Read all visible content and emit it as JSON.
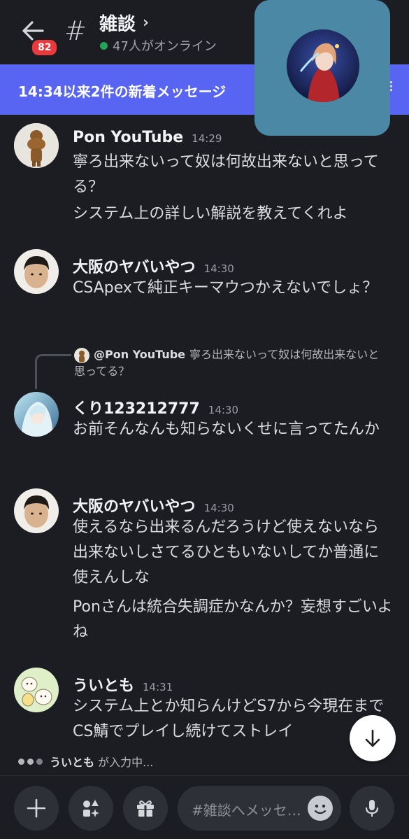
{
  "header": {
    "unread_badge": "82",
    "channel_name": "雑談",
    "online_text": "47人がオンライン"
  },
  "banner": {
    "text": "14:34以来2件の新着メッセージ"
  },
  "messages": [
    {
      "author": "Pon YouTube",
      "time": "14:29",
      "lines": [
        "寧ろ出来ないって奴は何故出来ないと思ってる？",
        "システム上の詳しい解説を教えてくれよ"
      ]
    },
    {
      "author": "大阪のヤバいやつ",
      "time": "14:30",
      "lines": [
        "CSApexて純正キーマウつかえないでしょ？"
      ]
    },
    {
      "author": "くり123212777",
      "time": "14:30",
      "reply": {
        "author": "@Pon YouTube",
        "text": "寧ろ出来ないって奴は何故出来ないと思ってる？"
      },
      "lines": [
        "お前そんなんも知らないくせに言ってたんか"
      ]
    },
    {
      "author": "大阪のヤバいやつ",
      "time": "14:30",
      "lines": [
        "使えるなら出来るんだろうけど使えないなら出来ないしさてるひともいないしてか普通に使えんしな",
        "Ponさんは統合失調症かなんか？妄想すごいよね"
      ]
    },
    {
      "author": "ういとも",
      "time": "14:31",
      "lines": [
        "システム上とか知らんけどS7から今現在までCS鯖でプレイし続けてストレイ"
      ]
    }
  ],
  "typing": {
    "user": "ういとも",
    "suffix": "が入力中..."
  },
  "composer": {
    "placeholder": "#雑談へメッセージを送信"
  },
  "icons": {
    "back": "arrow-left-icon",
    "channel": "hash-icon",
    "add": "plus-icon",
    "apps": "apps-icon",
    "gift": "gift-icon",
    "emoji": "emoji-icon",
    "mic": "mic-icon",
    "scroll": "arrow-down-icon"
  },
  "colors": {
    "background": "#1c1d22",
    "banner": "#5865f2",
    "badge": "#e8393d",
    "online": "#23a55a",
    "pip": "#4b88a6"
  }
}
